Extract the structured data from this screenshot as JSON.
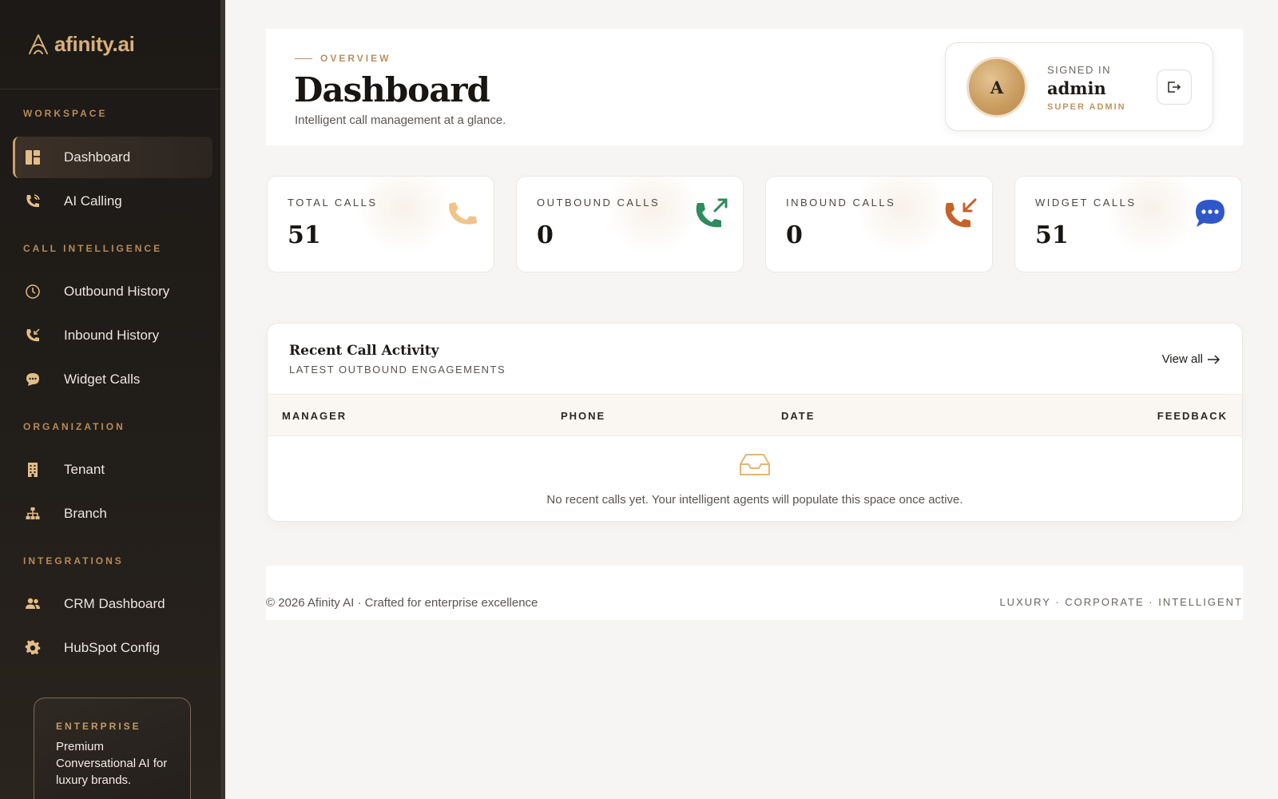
{
  "app": {
    "name": "afinity.ai"
  },
  "sidebar": {
    "sections": {
      "workspace": "WORKSPACE",
      "call_intelligence": "CALL INTELLIGENCE",
      "organization": "ORGANIZATION",
      "integrations": "INTEGRATIONS"
    },
    "items": [
      {
        "label": "Dashboard",
        "icon": "dashboard-icon",
        "active": true
      },
      {
        "label": "AI Calling",
        "icon": "phone-call-icon"
      },
      {
        "label": "Outbound History",
        "icon": "clock-icon"
      },
      {
        "label": "Inbound History",
        "icon": "phone-incoming-icon"
      },
      {
        "label": "Widget Calls",
        "icon": "chat-bubble-icon"
      },
      {
        "label": "Tenant",
        "icon": "building-icon"
      },
      {
        "label": "Branch",
        "icon": "hierarchy-icon"
      },
      {
        "label": "CRM Dashboard",
        "icon": "users-icon"
      },
      {
        "label": "HubSpot Config",
        "icon": "gear-icon"
      }
    ],
    "promo": {
      "tag": "ENTERPRISE",
      "text": "Premium Conversational AI for luxury brands."
    }
  },
  "header": {
    "overline": "OVERVIEW",
    "title": "Dashboard",
    "subtitle": "Intelligent call management at a glance.",
    "user": {
      "signed_in_label": "SIGNED IN",
      "name": "admin",
      "role": "SUPER ADMIN",
      "initial": "A"
    }
  },
  "stats": [
    {
      "label": "TOTAL CALLS",
      "value": "51",
      "icon": "phone-icon",
      "color": "#f0c489"
    },
    {
      "label": "OUTBOUND CALLS",
      "value": "0",
      "icon": "phone-outgoing-icon",
      "color": "#2f8a5c"
    },
    {
      "label": "INBOUND CALLS",
      "value": "0",
      "icon": "phone-incoming-icon",
      "color": "#c4622a"
    },
    {
      "label": "WIDGET CALLS",
      "value": "51",
      "icon": "chat-bubble-icon",
      "color": "#2f57c9"
    }
  ],
  "activity": {
    "title": "Recent Call Activity",
    "subtitle": "LATEST OUTBOUND ENGAGEMENTS",
    "view_all": "View all",
    "columns": [
      "MANAGER",
      "PHONE",
      "DATE",
      "FEEDBACK"
    ],
    "empty_text": "No recent calls yet. Your intelligent agents will populate this space once active."
  },
  "footer": {
    "left": "© 2026 Afinity AI · Crafted for enterprise excellence",
    "right": "LUXURY · CORPORATE · INTELLIGENT"
  },
  "colors": {
    "accent_gold": "#c9a06a",
    "sidebar_bg": "#1c1916",
    "page_bg": "#f6f5f3"
  }
}
